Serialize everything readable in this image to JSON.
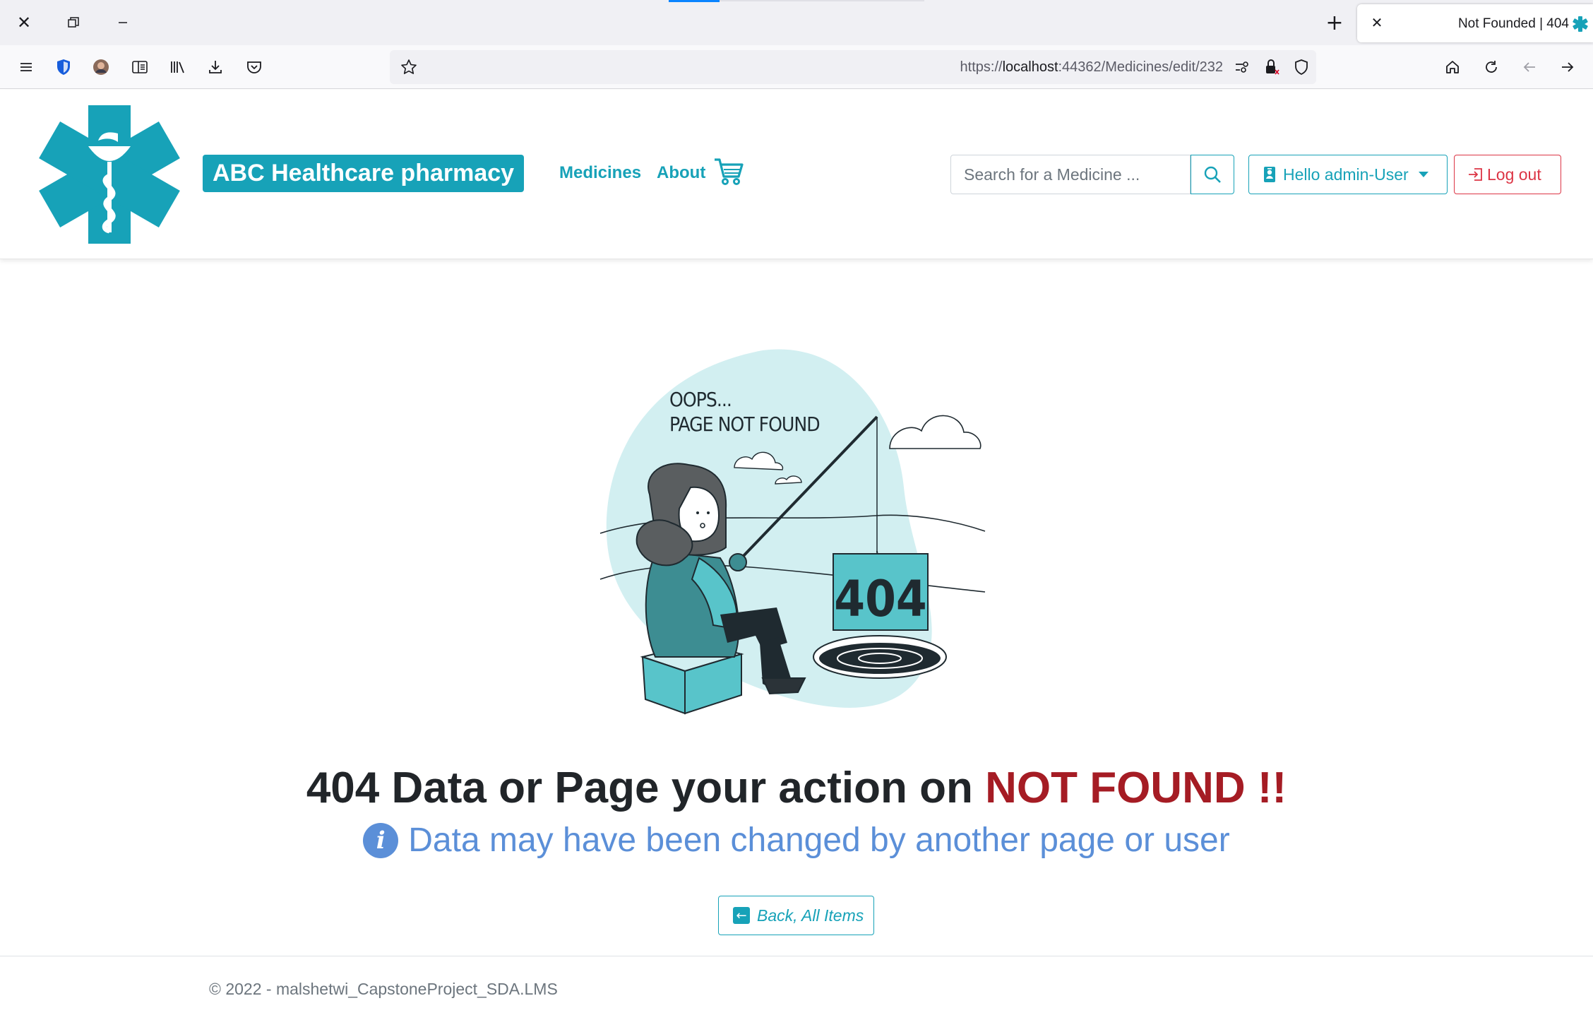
{
  "browser": {
    "tab_title": "Not Founded | 404",
    "url_prefix": "https://",
    "url_host": "localhost",
    "url_rest": ":44362/Medicines/edit/232",
    "icons": [
      "close-icon",
      "restore-icon",
      "minimize-icon",
      "new-tab-icon",
      "menu-icon",
      "shield-extension-icon",
      "profile-avatar",
      "sidebar-icon",
      "library-icon",
      "download-icon",
      "pocket-icon",
      "bookmark-star-icon",
      "permissions-icon",
      "lock-icon",
      "tracking-shield-icon",
      "home-icon",
      "reload-icon",
      "back-icon",
      "forward-icon"
    ]
  },
  "header": {
    "brand": "ABC Healthcare pharmacy",
    "nav": [
      {
        "label": "Medicines"
      },
      {
        "label": "About"
      }
    ],
    "search_placeholder": "Search for a Medicine ...",
    "user_label": "Hello admin-User",
    "logout_label": "Log out",
    "brand_color": "#17a2b8",
    "danger_color": "#dc3545"
  },
  "illustration": {
    "caption_line1": "OOPS...",
    "caption_line2": "PAGE NOT FOUND",
    "sign_text": "404"
  },
  "main": {
    "headline_prefix": "404 Data or Page your action on ",
    "headline_highlight": "NOT FOUND !!",
    "info_text": "Data may have been changed by another page or user",
    "info_icon": "i",
    "back_label": "Back, All Items"
  },
  "footer": {
    "text": "© 2022 - malshetwi_CapstoneProject_SDA.LMS"
  }
}
